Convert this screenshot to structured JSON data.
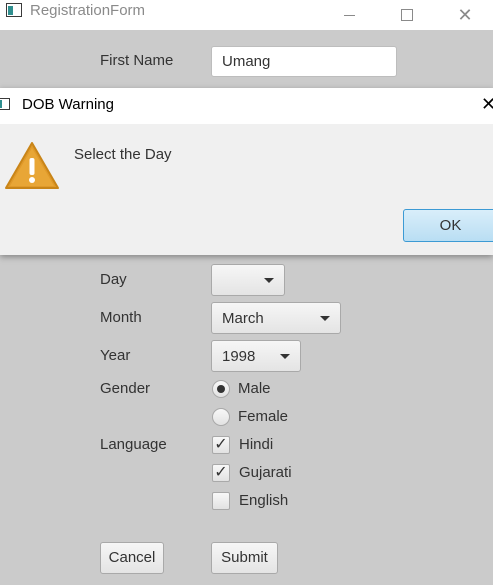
{
  "window": {
    "title": "RegistrationForm"
  },
  "form": {
    "first_name_label": "First Name",
    "first_name_value": "Umang",
    "day_label": "Day",
    "day_value": "",
    "month_label": "Month",
    "month_value": "March",
    "year_label": "Year",
    "year_value": "1998",
    "gender_label": "Gender",
    "gender_options": [
      {
        "label": "Male",
        "selected": true
      },
      {
        "label": "Female",
        "selected": false
      }
    ],
    "language_label": "Language",
    "languages": [
      {
        "label": "Hindi",
        "checked": true
      },
      {
        "label": "Gujarati",
        "checked": true
      },
      {
        "label": "English",
        "checked": false
      }
    ],
    "cancel_label": "Cancel",
    "submit_label": "Submit"
  },
  "dialog": {
    "title": "DOB Warning",
    "message": "Select the Day",
    "ok_label": "OK",
    "icon": "warning-icon",
    "icon_color": "#e09a2a"
  }
}
